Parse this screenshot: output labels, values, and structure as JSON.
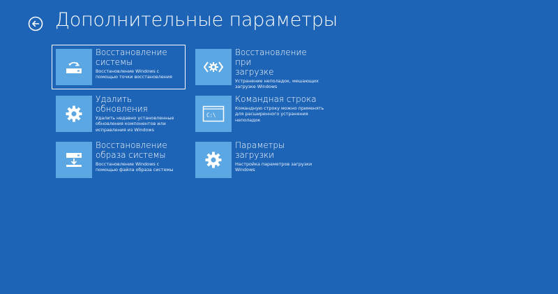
{
  "header": {
    "back_icon": "back-arrow-circle-icon",
    "title": "Дополнительные параметры"
  },
  "options": [
    {
      "title": "Восстановление\nсистемы",
      "description": "Восстановление Windows с\nпомощью точки восстановления",
      "icon": "system-restore-icon",
      "selected": true
    },
    {
      "title": "Удалить обновления",
      "description": "Удалить недавно установленные\nобновления компонентов или\nисправления из Windows",
      "icon": "gear-icon",
      "selected": false
    },
    {
      "title": "Восстановление\nобраза системы",
      "description": "Восстановление Windows с\nпомощью файла образа системы",
      "icon": "system-image-recovery-icon",
      "selected": false
    },
    {
      "title": "Восстановление при\nзагрузке",
      "description": "Устранение неполадок, мешающих\nзагрузке Windows",
      "icon": "startup-repair-icon",
      "selected": false
    },
    {
      "title": "Командная строка",
      "description": "Командную строку можно применять\nдля расширенного устранения\nнеполадок",
      "icon": "command-prompt-icon",
      "selected": false
    },
    {
      "title": "Параметры загрузки",
      "description": "Настройка параметров загрузки\nWindows",
      "icon": "gear-icon",
      "selected": false
    }
  ],
  "cmd_icon_text": "C:\\",
  "colors": {
    "background": "#1d64b6",
    "tile": "#5ba7e3",
    "text": "#ffffff"
  }
}
